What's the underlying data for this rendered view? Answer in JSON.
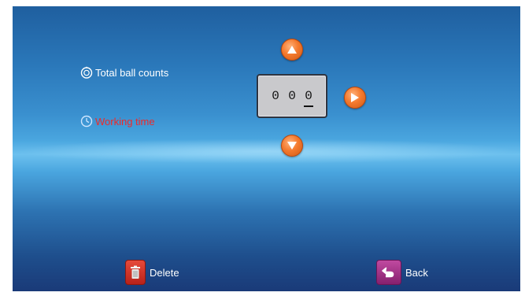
{
  "settings": {
    "total_label": "Total ball counts",
    "working_label": "Working time"
  },
  "counter": {
    "digits": [
      "0",
      "0",
      "0"
    ],
    "active_digit_index": 2
  },
  "footer": {
    "delete_label": "Delete",
    "back_label": "Back"
  },
  "colors": {
    "accent_orange": "#f47a2e",
    "selected_text": "#ee2a2a",
    "delete_red": "#d13a2a",
    "back_magenta": "#a8308a"
  },
  "icons": {
    "total": "stopwatch-icon",
    "working": "clock-icon",
    "up": "up-arrow-icon",
    "down": "down-arrow-icon",
    "right": "right-arrow-icon",
    "delete": "trash-icon",
    "back": "back-arrow-icon"
  }
}
